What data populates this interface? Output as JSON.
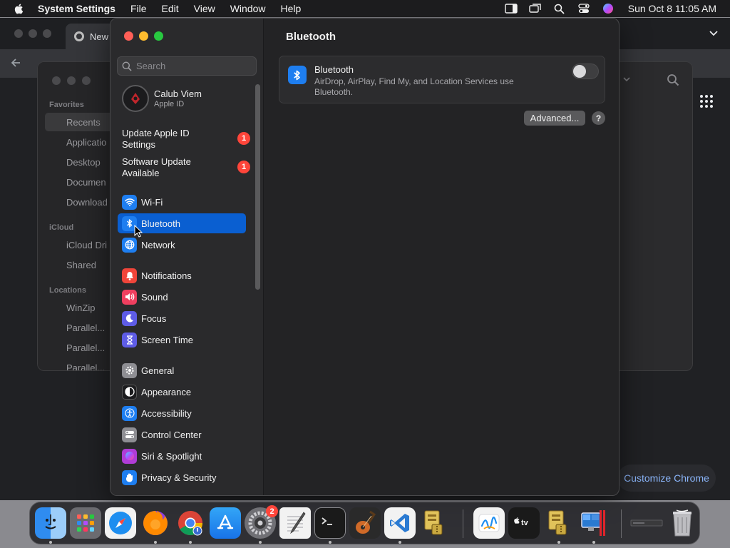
{
  "menubar": {
    "app_name": "System Settings",
    "menus": [
      "File",
      "Edit",
      "View",
      "Window",
      "Help"
    ],
    "clock": "Sun Oct 8  11:05 AM",
    "status_icons": [
      "display-icon",
      "screen-mirroring-icon",
      "spotlight-search-icon",
      "control-center-icon",
      "siri-icon"
    ]
  },
  "chrome": {
    "tab_title": "New",
    "customize_label": "Customize Chrome"
  },
  "finder": {
    "sections": [
      {
        "title": "Favorites",
        "items": [
          "Recents",
          "Applicatio",
          "Desktop",
          "Documen",
          "Download"
        ]
      },
      {
        "title": "iCloud",
        "items": [
          "iCloud Dri",
          "Shared"
        ]
      },
      {
        "title": "Locations",
        "items": [
          "WinZip",
          "Parallel...",
          "Parallel...",
          "Parallel..."
        ]
      }
    ]
  },
  "settings": {
    "search_placeholder": "Search",
    "profile": {
      "name": "Calub Viem",
      "subtitle": "Apple ID"
    },
    "notices": [
      {
        "label": "Update Apple ID Settings",
        "badge": "1"
      },
      {
        "label": "Software Update Available",
        "badge": "1"
      }
    ],
    "nav_groups": [
      [
        {
          "label": "Wi-Fi",
          "icon": "wifi-icon",
          "color": "#1e7ef0"
        },
        {
          "label": "Bluetooth",
          "icon": "bluetooth-icon",
          "color": "#1e7ef0",
          "selected": true
        },
        {
          "label": "Network",
          "icon": "globe-icon",
          "color": "#1e7ef0"
        }
      ],
      [
        {
          "label": "Notifications",
          "icon": "bell-icon",
          "color": "#f0453a"
        },
        {
          "label": "Sound",
          "icon": "speaker-icon",
          "color": "#ef3f5f"
        },
        {
          "label": "Focus",
          "icon": "moon-icon",
          "color": "#5e5ce6"
        },
        {
          "label": "Screen Time",
          "icon": "hourglass-icon",
          "color": "#5e5ce6"
        }
      ],
      [
        {
          "label": "General",
          "icon": "gear-icon",
          "color": "#8e8e93"
        },
        {
          "label": "Appearance",
          "icon": "appearance-icon",
          "color": "#1c1c1e"
        },
        {
          "label": "Accessibility",
          "icon": "accessibility-icon",
          "color": "#1e7ef0"
        },
        {
          "label": "Control Center",
          "icon": "control-center-icon",
          "color": "#8e8e93"
        },
        {
          "label": "Siri & Spotlight",
          "icon": "siri-icon",
          "color": "#b03cd6"
        },
        {
          "label": "Privacy & Security",
          "icon": "hand-icon",
          "color": "#1e7ef0"
        }
      ]
    ],
    "content": {
      "title": "Bluetooth",
      "bluetooth_name": "Bluetooth",
      "bluetooth_desc": "AirDrop, AirPlay, Find My, and Location Services use Bluetooth.",
      "bluetooth_on": false,
      "advanced_label": "Advanced...",
      "help_label": "?"
    }
  },
  "dock": {
    "apps": [
      {
        "name": "finder-app",
        "color": "#2f8cf0"
      },
      {
        "name": "launchpad-app",
        "color": "#6b6b70"
      },
      {
        "name": "safari-app",
        "color": "#1e8ef0"
      },
      {
        "name": "firefox-app",
        "color": "#e0532a"
      },
      {
        "name": "chrome-app",
        "color": "#e8e8e8"
      },
      {
        "name": "app-store-app",
        "color": "#1e8ef0"
      },
      {
        "name": "system-settings-app",
        "color": "#707075",
        "badge": "2"
      },
      {
        "name": "textedit-app",
        "color": "#f2f2f2"
      },
      {
        "name": "terminal-app",
        "color": "#1a1a1a"
      },
      {
        "name": "garageband-app",
        "color": "#2a2a2a"
      },
      {
        "name": "vscode-app",
        "color": "#2a7ad2"
      },
      {
        "name": "archive-utility-app",
        "color": "#c9a840"
      },
      {
        "name": "freeform-app",
        "color": "#f2f2f2"
      },
      {
        "name": "apple-tv-app",
        "color": "#1a1a1a"
      },
      {
        "name": "archive-app-2",
        "color": "#c9a840"
      },
      {
        "name": "parallels-app",
        "color": "#3a6ad0"
      },
      {
        "name": "minimized-window",
        "color": "#3a3a3c"
      },
      {
        "name": "trash-app",
        "color": "#9a9a9e"
      }
    ]
  }
}
